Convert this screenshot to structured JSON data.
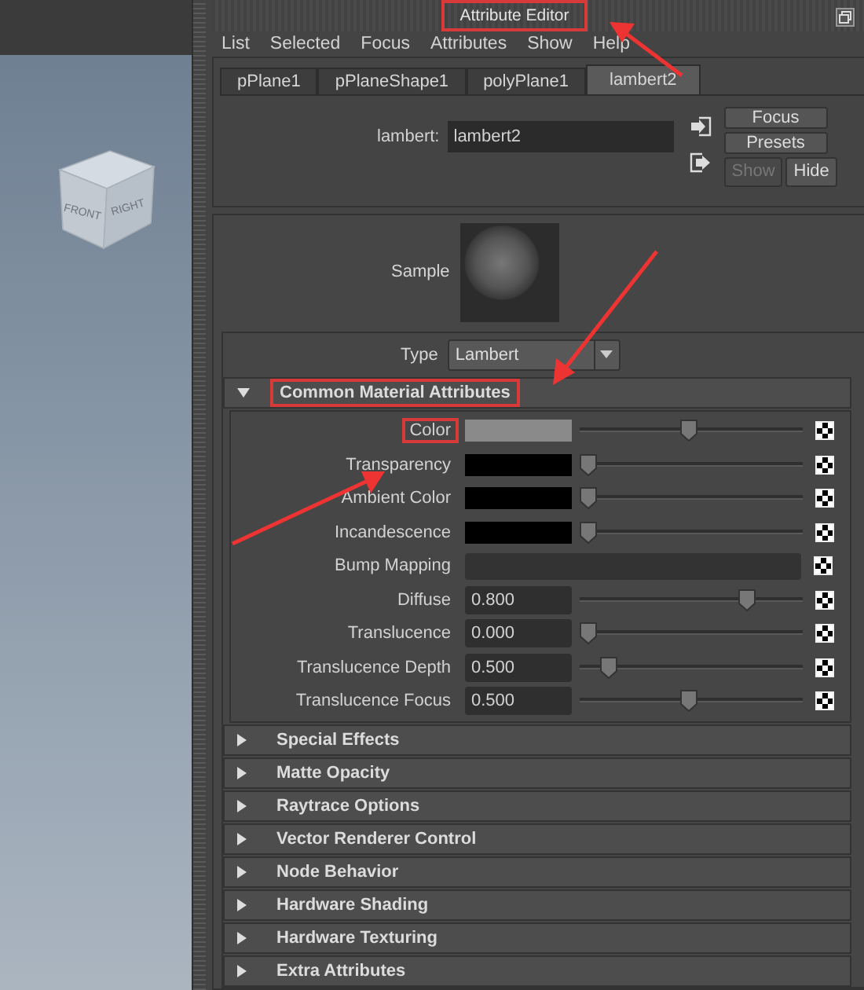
{
  "viewport": {
    "cube_labels": [
      "FRONT",
      "RIGHT"
    ]
  },
  "window": {
    "title": "Attribute Editor",
    "title_highlighted": true
  },
  "menu": [
    "List",
    "Selected",
    "Focus",
    "Attributes",
    "Show",
    "Help"
  ],
  "tabs": [
    {
      "label": "pPlane1",
      "selected": false
    },
    {
      "label": "pPlaneShape1",
      "selected": false
    },
    {
      "label": "polyPlane1",
      "selected": false
    },
    {
      "label": "lambert2",
      "selected": true
    }
  ],
  "node": {
    "label": "lambert:",
    "value": "lambert2"
  },
  "buttons": [
    {
      "label": "Focus",
      "disabled": false
    },
    {
      "label": "Presets",
      "disabled": false
    },
    {
      "label": "Show",
      "disabled": true
    },
    {
      "label": "Hide",
      "disabled": false
    }
  ],
  "sample": {
    "label": "Sample"
  },
  "type": {
    "label": "Type",
    "value": "Lambert"
  },
  "sections": [
    {
      "title": "Common Material Attributes",
      "expanded": true,
      "highlighted": true,
      "attributes": [
        {
          "kind": "color",
          "label": "Color",
          "highlighted": true,
          "color": "#8a8a8a",
          "level": 0.49
        },
        {
          "kind": "color",
          "label": "Transparency",
          "highlighted": false,
          "color": "#000000",
          "level": 0
        },
        {
          "kind": "color",
          "label": "Ambient Color",
          "highlighted": false,
          "color": "#000000",
          "level": 0
        },
        {
          "kind": "color",
          "label": "Incandescence",
          "highlighted": false,
          "color": "#000000",
          "level": 0
        },
        {
          "kind": "texture",
          "label": "Bump Mapping",
          "highlighted": false
        },
        {
          "kind": "number",
          "label": "Diffuse",
          "highlighted": false,
          "value": "0.800",
          "level": 0.77
        },
        {
          "kind": "number",
          "label": "Translucence",
          "highlighted": false,
          "value": "0.000",
          "level": 0
        },
        {
          "kind": "number",
          "label": "Translucence Depth",
          "highlighted": false,
          "value": "0.500",
          "level": 0.1
        },
        {
          "kind": "number",
          "label": "Translucence Focus",
          "highlighted": false,
          "value": "0.500",
          "level": 0.49
        }
      ]
    },
    {
      "title": "Special Effects",
      "expanded": false,
      "highlighted": false
    },
    {
      "title": "Matte Opacity",
      "expanded": false,
      "highlighted": false
    },
    {
      "title": "Raytrace Options",
      "expanded": false,
      "highlighted": false
    },
    {
      "title": "Vector Renderer Control",
      "expanded": false,
      "highlighted": false
    },
    {
      "title": "Node Behavior",
      "expanded": false,
      "highlighted": false
    },
    {
      "title": "Hardware Shading",
      "expanded": false,
      "highlighted": false
    },
    {
      "title": "Hardware Texturing",
      "expanded": false,
      "highlighted": false
    },
    {
      "title": "Extra Attributes",
      "expanded": false,
      "highlighted": false
    }
  ]
}
